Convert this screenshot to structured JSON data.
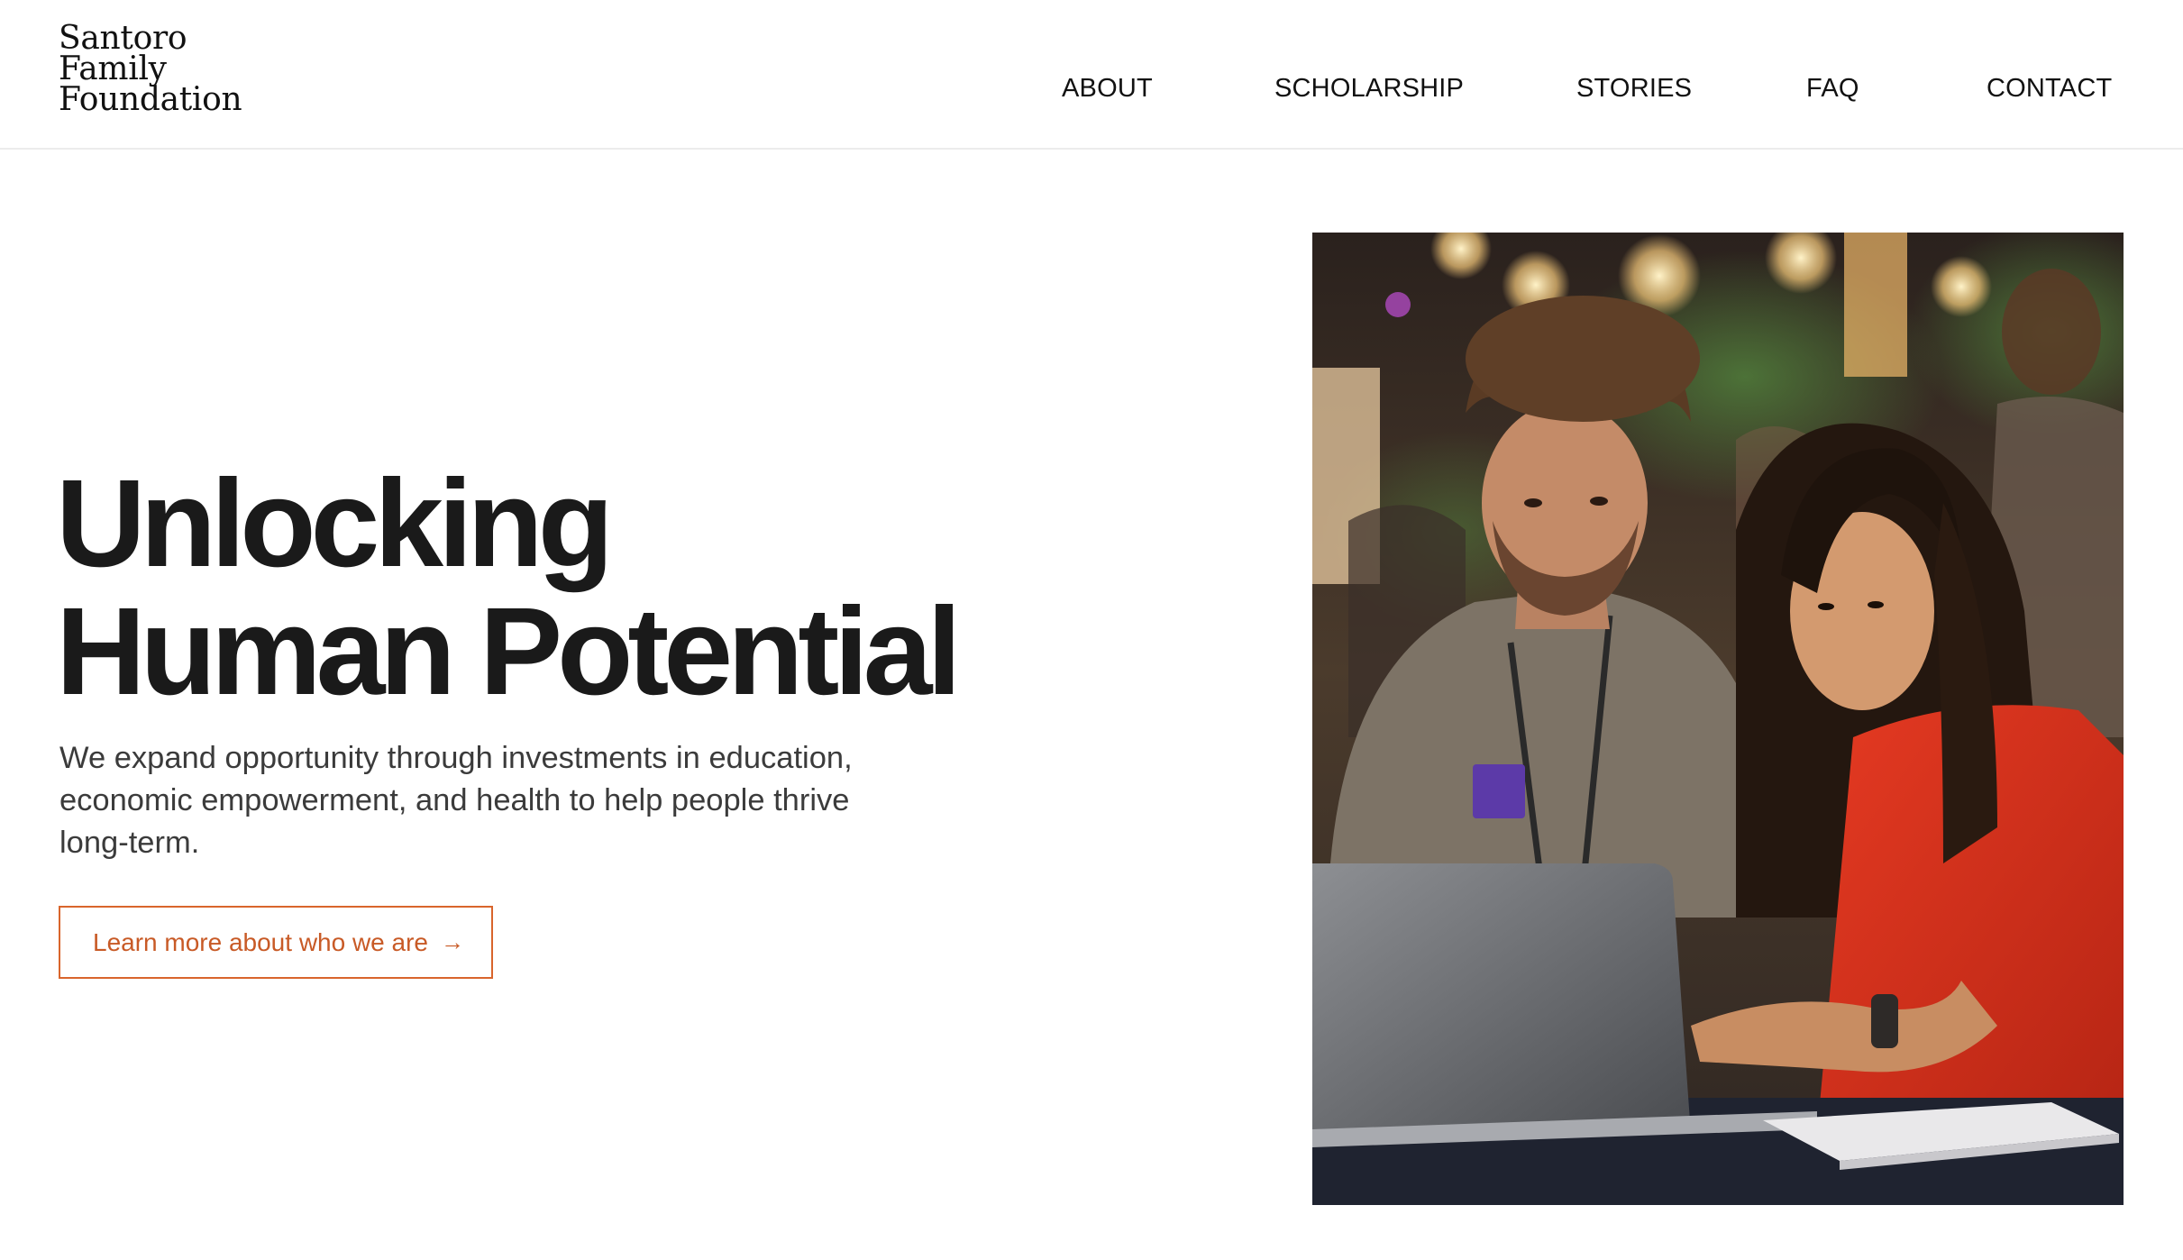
{
  "header": {
    "logo_lines": [
      "Santoro",
      "Family",
      "Foundation"
    ],
    "nav": {
      "about": "ABOUT",
      "scholarship": "SCHOLARSHIP",
      "stories": "STORIES",
      "faq": "FAQ",
      "contact": "CONTACT"
    }
  },
  "hero": {
    "title_lines": [
      "Unlocking",
      "Human Potential"
    ],
    "subtitle": "We expand opportunity through investments in education, economic empowerment, and health to help people thrive long-term.",
    "cta_label": "Learn more about who we are",
    "cta_icon": "arrow-right-icon",
    "cta_arrow": "→"
  },
  "colors": {
    "accent": "#d9652c",
    "text": "#1a1a1a",
    "subtext": "#3b3b3b",
    "border": "#ececec"
  }
}
